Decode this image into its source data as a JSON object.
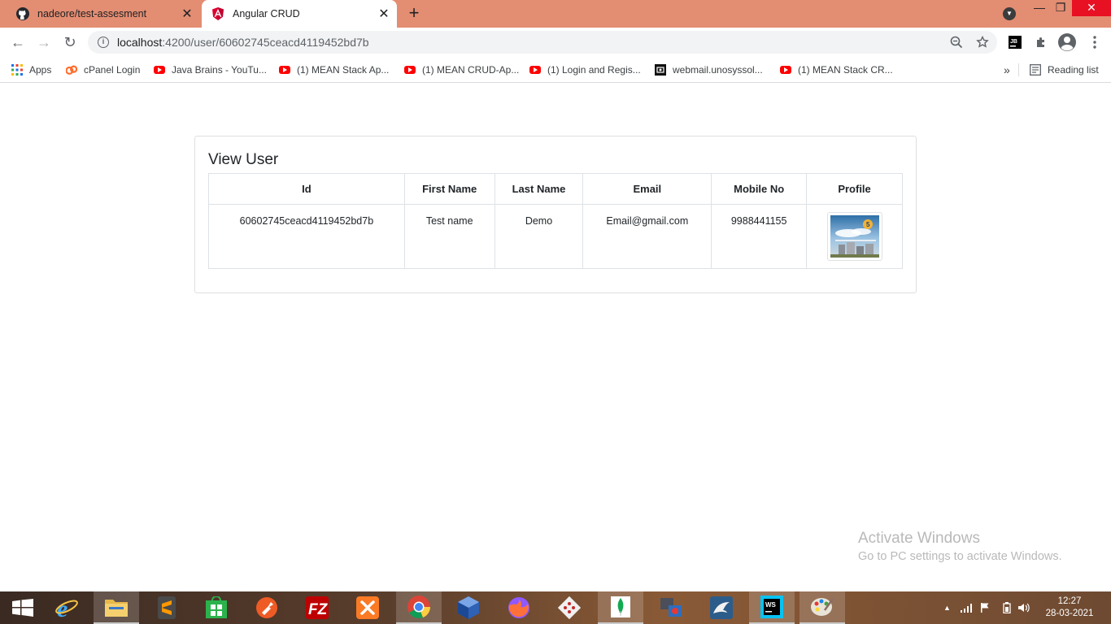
{
  "browser": {
    "tabs": [
      {
        "title": "nadeore/test-assesment",
        "icon": "github-icon",
        "active": false
      },
      {
        "title": "Angular CRUD",
        "icon": "angular-icon",
        "active": true
      }
    ],
    "new_tab": "+",
    "address": {
      "host": "localhost",
      "path": ":4200/user/60602745ceacd4119452bd7b"
    },
    "bookmarks": [
      {
        "label": "Apps",
        "icon": "apps-grid-icon"
      },
      {
        "label": "cPanel Login",
        "icon": "cpanel-icon"
      },
      {
        "label": "Java Brains - YouTu...",
        "icon": "youtube-icon"
      },
      {
        "label": "(1) MEAN Stack Ap...",
        "icon": "youtube-icon"
      },
      {
        "label": "(1) MEAN CRUD-Ap...",
        "icon": "youtube-icon"
      },
      {
        "label": "(1) Login and Regis...",
        "icon": "youtube-icon"
      },
      {
        "label": "webmail.unosyssol...",
        "icon": "webmail-icon"
      },
      {
        "label": "(1) MEAN Stack CR...",
        "icon": "youtube-icon"
      }
    ],
    "more_bookmarks": "»",
    "reading_list": "Reading list"
  },
  "page": {
    "title": "View User",
    "columns": [
      "Id",
      "First Name",
      "Last Name",
      "Email",
      "Mobile No",
      "Profile"
    ],
    "rows": [
      {
        "id": "60602745ceacd4119452bd7b",
        "first_name": "Test name",
        "last_name": "Demo",
        "email": "Email@gmail.com",
        "mobile": "9988441155",
        "profile": "profile-image"
      }
    ]
  },
  "watermark": {
    "line1": "Activate Windows",
    "line2": "Go to PC settings to activate Windows."
  },
  "taskbar": {
    "time": "12:27",
    "date": "28-03-2021",
    "apps": [
      "ie-icon",
      "file-explorer-icon",
      "sublime-icon",
      "store-icon",
      "postman-icon",
      "filezilla-icon",
      "xampp-icon",
      "chrome-icon",
      "virtualbox-icon",
      "firefox-icon",
      "git-icon",
      "mongodb-icon",
      "network-tool-icon",
      "mysql-workbench-icon",
      "webstorm-icon",
      "paint-icon"
    ]
  },
  "colors": {
    "tabstrip": "#e38d72",
    "close_button": "#e81123",
    "youtube": "#ff0000"
  }
}
